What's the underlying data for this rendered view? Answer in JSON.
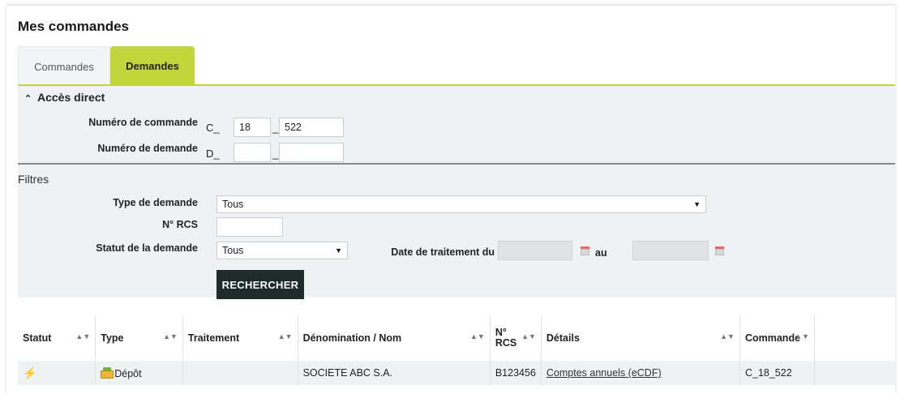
{
  "page": {
    "title": "Mes commandes"
  },
  "tabs": [
    {
      "label": "Commandes",
      "active": false
    },
    {
      "label": "Demandes",
      "active": true
    }
  ],
  "acces_direct": {
    "title": "Accès direct",
    "numero_commande": {
      "label": "Numéro de commande",
      "prefix": "C_",
      "sep": "_",
      "year": "18",
      "number": "522"
    },
    "numero_demande": {
      "label": "Numéro de demande",
      "prefix": "D_",
      "sep": "_",
      "year": "",
      "number": ""
    }
  },
  "filtres": {
    "title": "Filtres",
    "type_demande": {
      "label": "Type de demande",
      "value": "Tous"
    },
    "rcs": {
      "label": "N° RCS",
      "value": ""
    },
    "statut_demande": {
      "label": "Statut de la demande",
      "value": "Tous"
    },
    "date_traitement": {
      "label_from": "Date de traitement du",
      "label_to": "au",
      "from": "",
      "to": ""
    },
    "search_button": "RECHERCHER"
  },
  "table": {
    "columns": [
      "Statut",
      "Type",
      "Traitement",
      "Dénomination / Nom",
      "N° RCS",
      "Détails",
      "Commande",
      ""
    ],
    "rows": [
      {
        "statut": "⚡",
        "type": "Dépôt",
        "traitement": "",
        "denomination": "SOCIETE ABC S.A.",
        "rcs": "B123456",
        "details": "Comptes annuels (eCDF)",
        "commande": "C_18_522"
      }
    ]
  },
  "icons": {
    "accent_color": "#c2d53b",
    "button_color": "#1e2b2b",
    "panel_bg": "#eef2f2"
  }
}
